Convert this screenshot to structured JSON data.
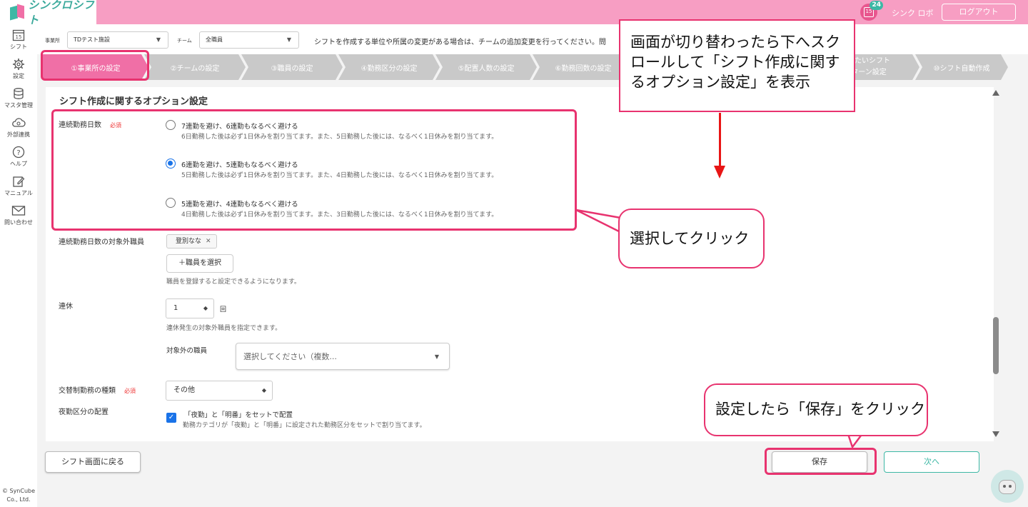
{
  "header": {
    "logo_text": "シンクロシフト",
    "calendar_day": "15",
    "notification_count": "24",
    "user_name": "シンク ロボ",
    "logout_label": "ログアウト"
  },
  "sidebar": {
    "items": [
      {
        "label": "シフト",
        "icon": "calendar-icon"
      },
      {
        "label": "設定",
        "icon": "gear-icon"
      },
      {
        "label": "マスタ管理",
        "icon": "database-icon"
      },
      {
        "label": "外部連携",
        "icon": "cloud-sync-icon"
      },
      {
        "label": "ヘルプ",
        "icon": "help-icon"
      },
      {
        "label": "マニュアル",
        "icon": "edit-icon"
      },
      {
        "label": "問い合わせ",
        "icon": "mail-icon"
      }
    ],
    "calendar_day": "15",
    "copyright_line1": "© SynCube",
    "copyright_line2": "Co., Ltd."
  },
  "filters": {
    "office_label": "事業所",
    "office_value": "TDテスト施設",
    "team_label": "チーム",
    "team_value": "全職員",
    "note": "シフトを作成する単位や所属の変更がある場合は、チームの追加変更を行ってください。問"
  },
  "steps": [
    {
      "label": "①事業所の設定",
      "active": true
    },
    {
      "label": "②チームの設定",
      "active": false
    },
    {
      "label": "③職員の設定",
      "active": false
    },
    {
      "label": "④勤務区分の設定",
      "active": false
    },
    {
      "label": "⑤配置人数の設定",
      "active": false
    },
    {
      "label": "⑥勤務回数の設定",
      "active": false
    },
    {
      "label": "したいシフト",
      "active": false
    },
    {
      "label": "⑩シフト自動作成",
      "active": false
    }
  ],
  "steps_partial": "ターン設定",
  "section_title": "シフト作成に関するオプション設定",
  "consecutive": {
    "label": "連続勤務日数",
    "required": "必須",
    "options": [
      {
        "title": "7連勤を避け、6連勤もなるべく避ける",
        "desc": "6日勤務した後は必ず1日休みを割り当てます。また、5日勤務した後には、なるべく1日休みを割り当てます。",
        "checked": false
      },
      {
        "title": "6連勤を避け、5連勤もなるべく避ける",
        "desc": "5日勤務した後は必ず1日休みを割り当てます。また、4日勤務した後には、なるべく1日休みを割り当てます。",
        "checked": true
      },
      {
        "title": "5連勤を避け、4連勤もなるべく避ける",
        "desc": "4日勤務した後は必ず1日休みを割り当てます。また、3日勤務した後には、なるべく1日休みを割り当てます。",
        "checked": false
      }
    ]
  },
  "excluded_staff": {
    "label": "連続勤務日数の対象外職員",
    "chip": "登別なな",
    "button": "＋職員を選択",
    "hint": "職員を登録すると設定できるようになります。"
  },
  "renkyu": {
    "label": "連休",
    "value": "1",
    "unit": "回",
    "hint": "連休発生の対象外職員を指定できます。",
    "sub_label": "対象外の職員",
    "placeholder": "選択してください（複数..."
  },
  "shift_type": {
    "label": "交替制勤務の種類",
    "required": "必須",
    "value": "その他"
  },
  "night": {
    "label": "夜勤区分の配置",
    "check_label": "「夜勤」と「明番」をセットで配置",
    "desc": "勤務カテゴリが「夜勤」と「明番」に設定された勤務区分をセットで割り当てます。"
  },
  "buttons": {
    "back": "シフト画面に戻る",
    "save": "保存",
    "next": "次へ"
  },
  "annotations": {
    "top_note": "画面が切り替わったら下へスクロールして「シフト作成に関するオプション設定」を表示",
    "select_note": "選択してクリック",
    "save_note": "設定したら「保存」をクリック"
  },
  "colors": {
    "brand_pink": "#f79ec3",
    "active_step": "#f06fa6",
    "accent_teal": "#3db8a5",
    "highlight": "#e8336f"
  }
}
